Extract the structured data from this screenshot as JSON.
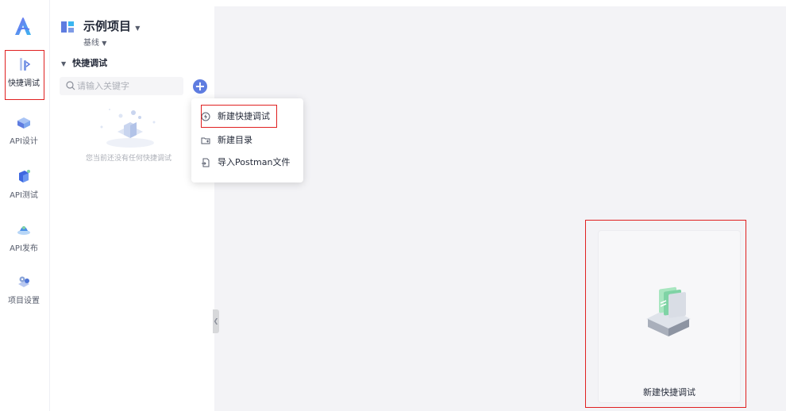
{
  "project": {
    "name": "示例项目",
    "branch": "基线"
  },
  "nav": [
    {
      "label": "快捷调试",
      "icon": "quick-debug-icon",
      "active": true
    },
    {
      "label": "API设计",
      "icon": "api-design-icon"
    },
    {
      "label": "API测试",
      "icon": "api-test-icon"
    },
    {
      "label": "API发布",
      "icon": "api-publish-icon"
    },
    {
      "label": "项目设置",
      "icon": "project-settings-icon"
    }
  ],
  "section": {
    "title": "快捷调试"
  },
  "search": {
    "placeholder": "请输入关键字"
  },
  "empty_state": {
    "text": "您当前还没有任何快捷调试"
  },
  "menu": {
    "items": [
      {
        "label": "新建快捷调试",
        "icon": "new-quick-debug-icon"
      },
      {
        "label": "新建目录",
        "icon": "new-folder-icon"
      },
      {
        "label": "导入Postman文件",
        "icon": "import-file-icon"
      }
    ]
  },
  "card": {
    "label": "新建快捷调试"
  },
  "colors": {
    "accent": "#5e7ce0",
    "highlight": "#e02020",
    "main_bg": "#f3f3f6"
  }
}
